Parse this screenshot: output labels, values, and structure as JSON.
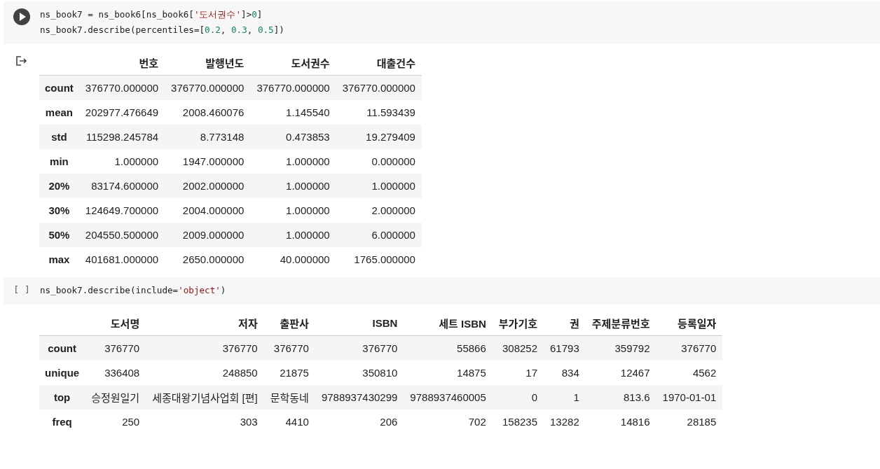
{
  "cells": [
    {
      "run_indicator": {
        "kind": "play"
      },
      "code": [
        [
          {
            "kind": "plain",
            "text": "ns_book7 = ns_book6[ns_book6["
          },
          {
            "kind": "string",
            "text": "'도서권수'"
          },
          {
            "kind": "plain",
            "text": "]>"
          },
          {
            "kind": "number",
            "text": "0"
          },
          {
            "kind": "plain",
            "text": "]"
          }
        ],
        [
          {
            "kind": "plain",
            "text": "ns_book7.describe(percentiles=["
          },
          {
            "kind": "number",
            "text": "0.2"
          },
          {
            "kind": "plain",
            "text": ", "
          },
          {
            "kind": "number",
            "text": "0.3"
          },
          {
            "kind": "plain",
            "text": ", "
          },
          {
            "kind": "number",
            "text": "0.5"
          },
          {
            "kind": "plain",
            "text": "])"
          }
        ]
      ],
      "output": {
        "marker": true,
        "table": {
          "columns": [
            "번호",
            "발행년도",
            "도서권수",
            "대출건수"
          ],
          "rows": [
            {
              "index": "count",
              "values": [
                "376770.000000",
                "376770.000000",
                "376770.000000",
                "376770.000000"
              ]
            },
            {
              "index": "mean",
              "values": [
                "202977.476649",
                "2008.460076",
                "1.145540",
                "11.593439"
              ]
            },
            {
              "index": "std",
              "values": [
                "115298.245784",
                "8.773148",
                "0.473853",
                "19.279409"
              ]
            },
            {
              "index": "min",
              "values": [
                "1.000000",
                "1947.000000",
                "1.000000",
                "0.000000"
              ]
            },
            {
              "index": "20%",
              "values": [
                "83174.600000",
                "2002.000000",
                "1.000000",
                "1.000000"
              ]
            },
            {
              "index": "30%",
              "values": [
                "124649.700000",
                "2004.000000",
                "1.000000",
                "2.000000"
              ]
            },
            {
              "index": "50%",
              "values": [
                "204550.500000",
                "2009.000000",
                "1.000000",
                "6.000000"
              ]
            },
            {
              "index": "max",
              "values": [
                "401681.000000",
                "2650.000000",
                "40.000000",
                "1765.000000"
              ]
            }
          ]
        }
      }
    },
    {
      "run_indicator": {
        "kind": "brackets",
        "text": "[ ]"
      },
      "code": [
        [
          {
            "kind": "plain",
            "text": "ns_book7.describe(include="
          },
          {
            "kind": "string",
            "text": "'object'"
          },
          {
            "kind": "plain",
            "text": ")"
          }
        ]
      ],
      "output": {
        "marker": false,
        "table": {
          "columns": [
            "도서명",
            "저자",
            "출판사",
            "ISBN",
            "세트 ISBN",
            "부가기호",
            "권",
            "주제분류번호",
            "등록일자"
          ],
          "rows": [
            {
              "index": "count",
              "values": [
                "376770",
                "376770",
                "376770",
                "376770",
                "55866",
                "308252",
                "61793",
                "359792",
                "376770"
              ]
            },
            {
              "index": "unique",
              "values": [
                "336408",
                "248850",
                "21875",
                "350810",
                "14875",
                "17",
                "834",
                "12467",
                "4562"
              ]
            },
            {
              "index": "top",
              "values": [
                "승정원일기",
                "세종대왕기념사업회 [편]",
                "문학동네",
                "9788937430299",
                "9788937460005",
                "0",
                "1",
                "813.6",
                "1970-01-01"
              ]
            },
            {
              "index": "freq",
              "values": [
                "250",
                "303",
                "4410",
                "206",
                "702",
                "158235",
                "13282",
                "14816",
                "28185"
              ]
            }
          ]
        }
      }
    }
  ]
}
